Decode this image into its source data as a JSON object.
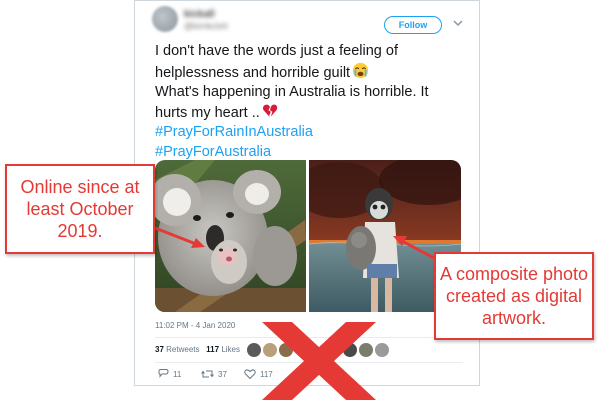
{
  "tweet": {
    "author_name": "kickall",
    "author_handle": "@kimkcloh",
    "follow_label": "Follow",
    "lines": [
      {
        "text": "I don't have the words just a feeling of",
        "emoji": ""
      },
      {
        "text": "helplessness and horrible guilt",
        "emoji": "crying-face"
      },
      {
        "text": "What's happening in Australia is horrible. It",
        "emoji": ""
      },
      {
        "text": "hurts my heart ..",
        "emoji": "broken-heart"
      }
    ],
    "hashtags": [
      "#PrayForRainInAustralia",
      "#PrayForAustralia"
    ],
    "timestamp": "11:02 PM - 4 Jan 2020",
    "retweets_count": "37",
    "retweets_label": "Retweets",
    "likes_count": "117",
    "likes_label": "Likes",
    "reply_count": "11",
    "retweet_action_count": "37",
    "like_action_count": "117"
  },
  "annotations": {
    "left_callout": "Online since at least October 2019.",
    "right_callout": "A composite photo created as digital artwork.",
    "accent_color": "#e53935"
  },
  "colors": {
    "link": "#1da1f2",
    "text": "#14171a",
    "muted": "#657786"
  }
}
